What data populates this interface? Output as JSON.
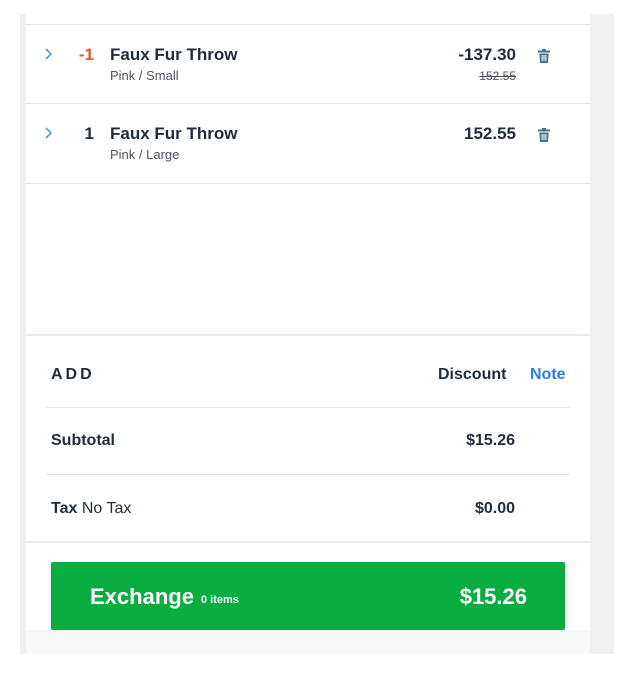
{
  "line_items": [
    {
      "quantity": "-1",
      "name": "Faux Fur Throw",
      "variant": "Pink / Small",
      "price": "-137.30",
      "original_price": "152.55",
      "expand_icon": "chevron-right-icon",
      "delete_icon": "trash-icon"
    },
    {
      "quantity": "1",
      "name": "Faux Fur Throw",
      "variant": "Pink / Large",
      "price": "152.55",
      "expand_icon": "chevron-right-icon",
      "delete_icon": "trash-icon"
    }
  ],
  "add_section": {
    "label": "ADD",
    "discount_label": "Discount",
    "note_label": "Note"
  },
  "summary": {
    "subtotal_label": "Subtotal",
    "subtotal_value": "$15.26",
    "tax_label": "Tax",
    "tax_detail": "No Tax",
    "tax_value": "$0.00"
  },
  "exchange_button": {
    "label": "Exchange",
    "item_count": "0 items",
    "total": "$15.26"
  },
  "colors": {
    "negative_quantity": "#e8552f",
    "link": "#2a7fd4",
    "chevron": "#5c9bd1",
    "primary_button": "#0aad3f",
    "text": "#1f2d3a"
  }
}
